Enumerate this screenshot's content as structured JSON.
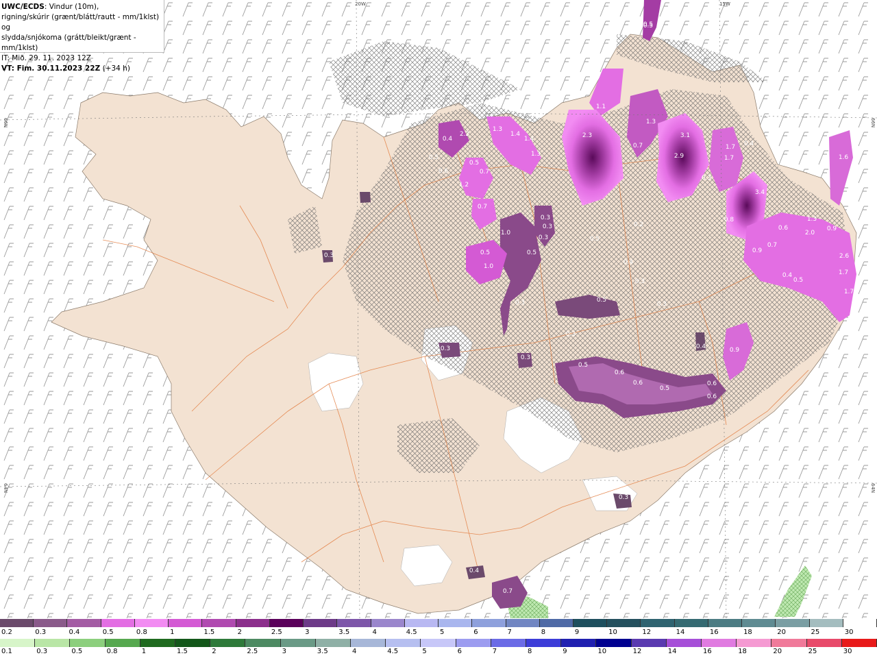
{
  "header": {
    "model": "UWC/ECDS",
    "line1": ": Vindur (10m),",
    "line2": "rigning/skúrir (grænt/blátt/rautt - mm/1klst) og",
    "line3": "slydda/snjókoma (grátt/bleikt/grænt - mm/1klst)",
    "issue": "IT: Mið. 29. 11. 2023 12Z",
    "valid_bold": "VT: Fim. 30.11.2023 22Z",
    "valid_offset": " (+34 h)"
  },
  "grid_labels": {
    "lon_20w": "20W",
    "lon_15w": "15W",
    "lat_66n_left": "66N",
    "lat_66n_right": "66N",
    "lat_64n_left": "64N",
    "lat_64n_right": "64N"
  },
  "precip_labels": [
    "0.5",
    "0.4",
    "2.2",
    "0.5",
    "0.6",
    "0.5",
    "1.2",
    "0.7",
    "1.3",
    "1.4",
    "1.4",
    "1.3",
    "1.1",
    "2.3",
    "1.3",
    "0.7",
    "3.1",
    "2.9",
    "1.7",
    "1.7",
    "0.4",
    "0.3",
    "1.6",
    "3.4",
    "0.8",
    "0.6",
    "1.3",
    "2.0",
    "0.9",
    "0.7",
    "0.9",
    "2.6",
    "0.4",
    "0.5",
    "1.7",
    "1.7",
    "0.5",
    "0.7",
    "1.0",
    "0.5",
    "0.3",
    "0.3",
    "0.3",
    "1.0",
    "0.5",
    "0.3",
    "0.2",
    "0.5",
    "0.4",
    "0.3",
    "0.3",
    "0.5",
    "0.3",
    "0.3",
    "0.3",
    "0.3",
    "0.9",
    "0.4",
    "0.5",
    "0.6",
    "0.6",
    "0.5",
    "0.6",
    "0.6",
    "0.4",
    "0.7",
    "0.3"
  ],
  "snow_scale": {
    "labels": [
      "0.2",
      "0.3",
      "0.4",
      "0.5",
      "0.8",
      "1",
      "1.5",
      "2",
      "2.5",
      "3",
      "3.5",
      "4",
      "4.5",
      "5",
      "6",
      "7",
      "8",
      "9",
      "10",
      "12",
      "14",
      "16",
      "18",
      "20",
      "25",
      "30"
    ],
    "colors": [
      "#6b4a6b",
      "#8a5a8a",
      "#a45ca4",
      "#e36ee3",
      "#f28cf2",
      "#d45ad4",
      "#b04ab0",
      "#8c2f8c",
      "#5a005a",
      "#6d3a88",
      "#7d56a9",
      "#9a86cc",
      "#b8b8f2",
      "#a9b6ee",
      "#8ea0dc",
      "#7186c2",
      "#4f6aa6",
      "#1e4f5e",
      "#24505e",
      "#2f6370",
      "#356a72",
      "#4c7c83",
      "#5f8b92",
      "#7a9ea3",
      "#a4bdbf",
      "#ffffff"
    ]
  },
  "rain_scale": {
    "labels": [
      "0.1",
      "0.3",
      "0.5",
      "0.8",
      "1",
      "1.5",
      "2",
      "2.5",
      "3",
      "3.5",
      "4",
      "4.5",
      "5",
      "6",
      "7",
      "8",
      "9",
      "10",
      "12",
      "14",
      "16",
      "18",
      "20",
      "25",
      "30"
    ],
    "colors": [
      "#d7f5c9",
      "#b9e6a6",
      "#8ccf7d",
      "#56a84f",
      "#1f6a1f",
      "#13571a",
      "#2e7a3a",
      "#4d8a62",
      "#6a9a86",
      "#8fb0a6",
      "#a7b7d8",
      "#b6bff0",
      "#c7c7f8",
      "#9c9cf0",
      "#6b6be6",
      "#3c3cd8",
      "#2020b0",
      "#000090",
      "#5a3ab0",
      "#a64fd8",
      "#e07be0",
      "#f59ad2",
      "#f07a9a",
      "#e84a6a",
      "#e81a1a"
    ]
  }
}
